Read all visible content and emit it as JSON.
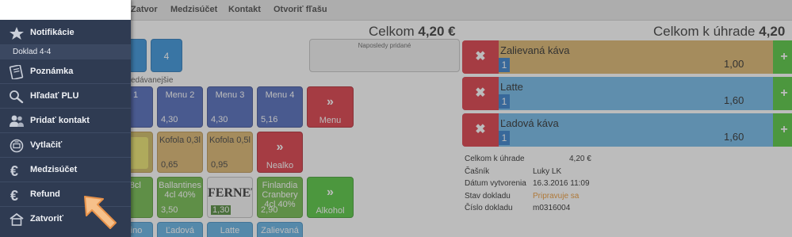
{
  "menubar": {
    "items": [
      "Zatvor",
      "Medzisúčet",
      "Kontakt",
      "Otvoriť fľašu"
    ]
  },
  "totals": {
    "left_label": "Celkom",
    "left_value": "4,20 €",
    "right_label": "Celkom k úhrade",
    "right_value": "4,20 €"
  },
  "top_buttons": {
    "four": "4"
  },
  "recent": {
    "label": "Naposledy pridané"
  },
  "section_label": "edávanejšie",
  "tiles": {
    "menu1": {
      "name": "u 1"
    },
    "menu2": {
      "name": "Menu 2",
      "price": "4,30"
    },
    "menu3": {
      "name": "Menu 3",
      "price": "4,30"
    },
    "menu4": {
      "name": "Menu 4",
      "price": "5,16"
    },
    "menu_nav": {
      "label": "Menu"
    },
    "kofola03": {
      "name": "Kofola 0,3l",
      "price": "0,65"
    },
    "kofola05": {
      "name": "Kofola 0,5l",
      "price": "0,95"
    },
    "napoje": {
      "label": "Nealko"
    },
    "vodka": {
      "name": "s 8cl"
    },
    "ballantines": {
      "name": "Ballantines 4cl 40%",
      "price": "3,50"
    },
    "fernet": {
      "name": "FERNET",
      "price": "1,30"
    },
    "finlandia": {
      "name": "Finlandia Cranbery 4cl 40%",
      "price": "2,90"
    },
    "alkohol": {
      "label": "Alkohol"
    },
    "row4a": {
      "name": "ccino"
    },
    "row4b": {
      "name": "Ľadová"
    },
    "row4c": {
      "name": "Latte"
    },
    "row4d": {
      "name": "Zalievaná"
    }
  },
  "order_items": [
    {
      "name": "Zalievaná káva",
      "qty": "1",
      "price": "1,00",
      "color": "#d8ad5c"
    },
    {
      "name": "Latte",
      "qty": "1",
      "price": "1,60",
      "color": "#5fb0e6"
    },
    {
      "name": "Ľadová káva",
      "qty": "1",
      "price": "1,60",
      "color": "#5fb0e6"
    }
  ],
  "receipt": {
    "total_label": "Celkom k úhrade",
    "total_value": "4,20 €",
    "waiter_label": "Čašník",
    "waiter_value": "Luky LK",
    "created_label": "Dátum vytvorenia",
    "created_value": "16.3.2016 11:09",
    "status_label": "Stav dokladu",
    "status_value": "Pripravuje sa",
    "number_label": "Číslo dokladu",
    "number_value": "m0316004"
  },
  "side_menu": {
    "notifications": "Notifikácie",
    "document": "Doklad 4-4",
    "note": "Poznámka",
    "search_plu": "Hľadať PLU",
    "add_contact": "Pridať kontakt",
    "print": "Vytlačiť",
    "subtotal": "Medzisúčet",
    "refund": "Refund",
    "close": "Zatvoriť"
  },
  "colors": {
    "sidebar_bg": "#2f3b52",
    "accent_blue": "#3a56b2",
    "delete_red": "#d7232f",
    "add_green": "#3fbf27",
    "status_orange": "#e88c1e"
  },
  "icons": [
    "star-icon",
    "note-icon",
    "search-icon",
    "users-icon",
    "print-icon",
    "euro-icon",
    "euro-icon",
    "home-icon",
    "zoom-in-icon",
    "pointer-arrow-icon",
    "close-icon",
    "plus-icon",
    "chevron-right-icon"
  ]
}
